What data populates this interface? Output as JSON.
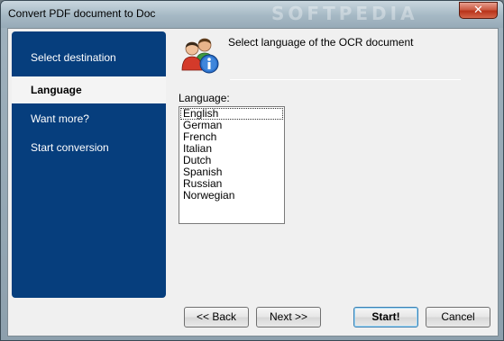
{
  "window": {
    "title": "Convert PDF document to Doc",
    "close_glyph": "✕"
  },
  "sidebar": {
    "items": [
      {
        "label": "Select destination",
        "active": false
      },
      {
        "label": "Language",
        "active": true
      },
      {
        "label": "Want more?",
        "active": false
      },
      {
        "label": "Start conversion",
        "active": false
      }
    ]
  },
  "header": {
    "icon": "users-info-icon",
    "text": "Select language of the OCR document"
  },
  "language": {
    "label": "Language:",
    "options": [
      "English",
      "German",
      "French",
      "Italian",
      "Dutch",
      "Spanish",
      "Russian",
      "Norwegian"
    ],
    "selected": "English"
  },
  "buttons": {
    "back": "<< Back",
    "next": "Next >>",
    "start": "Start!",
    "cancel": "Cancel"
  },
  "watermark": "SOFTPEDIA"
}
